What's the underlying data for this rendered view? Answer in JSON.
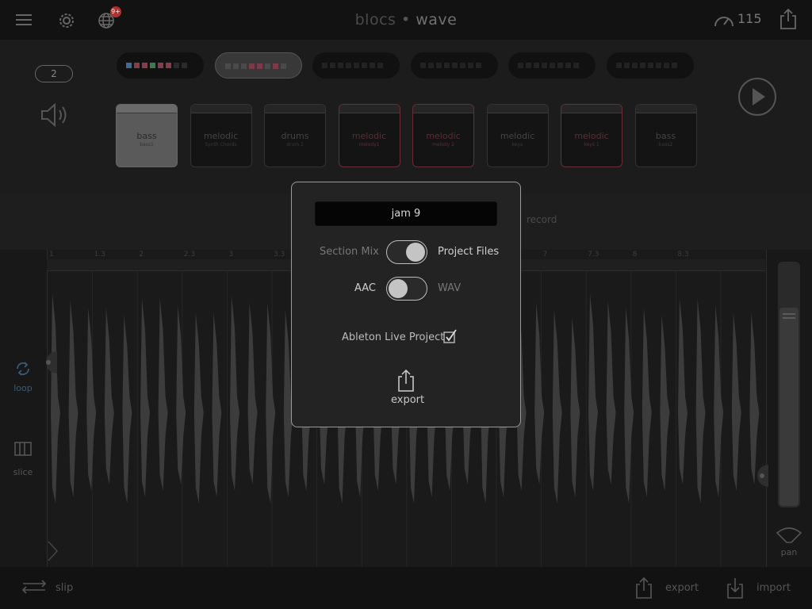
{
  "app": {
    "title_left": "blocs",
    "title_sep": "•",
    "title_right": "wave",
    "notification_count": "9+"
  },
  "header": {
    "tempo": "115"
  },
  "section": {
    "number": "2"
  },
  "presets": [
    {
      "active": false,
      "colors": [
        "#3b6a9a",
        "#8a3a4a",
        "#8a3a4a",
        "#3b7a4a",
        "#8a3a4a",
        "#8a3a4a",
        "#2a2a2a",
        "#2a2a2a"
      ]
    },
    {
      "active": true,
      "colors": [
        "#4a4a4a",
        "#4a4a4a",
        "#4a4a4a",
        "#7a3a4a",
        "#7a3a4a",
        "#4a4a4a",
        "#7a3a4a",
        "#4a4a4a"
      ]
    },
    {
      "active": false,
      "colors": [
        "#222",
        "#222",
        "#222",
        "#222",
        "#222",
        "#222",
        "#222",
        "#222"
      ]
    },
    {
      "active": false,
      "colors": [
        "#222",
        "#222",
        "#222",
        "#222",
        "#222",
        "#222",
        "#222",
        "#222"
      ]
    },
    {
      "active": false,
      "colors": [
        "#222",
        "#222",
        "#222",
        "#222",
        "#222",
        "#222",
        "#222",
        "#222"
      ]
    },
    {
      "active": false,
      "colors": [
        "#222",
        "#222",
        "#222",
        "#222",
        "#222",
        "#222",
        "#222",
        "#222"
      ]
    }
  ],
  "tracks": [
    {
      "name": "bass",
      "sub": "bass1",
      "style": "sel"
    },
    {
      "name": "melodic",
      "sub": "Synth Chords",
      "style": ""
    },
    {
      "name": "drums",
      "sub": "drum 1",
      "style": ""
    },
    {
      "name": "melodic",
      "sub": "melody1",
      "style": "red"
    },
    {
      "name": "melodic",
      "sub": "melody 2",
      "style": "red"
    },
    {
      "name": "melodic",
      "sub": "keys",
      "style": ""
    },
    {
      "name": "melodic",
      "sub": "keys 1",
      "style": "red"
    },
    {
      "name": "bass",
      "sub": "bass2",
      "style": ""
    }
  ],
  "band": {
    "record_label": "record"
  },
  "ruler": [
    "1",
    "1.3",
    "2",
    "2.3",
    "3",
    "3.3",
    "",
    "",
    "",
    "",
    "6.3",
    "7",
    "7.3",
    "8",
    "8.3"
  ],
  "side": {
    "loop_label": "loop",
    "slice_label": "slice",
    "pan_label": "pan"
  },
  "bottom": {
    "slip_label": "slip",
    "export_label": "export",
    "import_label": "import"
  },
  "modal": {
    "name_value": "jam 9",
    "toggle1": {
      "left_label": "Section Mix",
      "right_label": "Project Files",
      "state": "right"
    },
    "toggle2": {
      "left_label": "AAC",
      "right_label": "WAV",
      "state": "left"
    },
    "ableton_label": "Ableton Live Project",
    "ableton_checked": true,
    "export_label": "export"
  },
  "colors": {
    "accent_loop": "#3a5a78",
    "modal_border": "#9a9a9a"
  }
}
